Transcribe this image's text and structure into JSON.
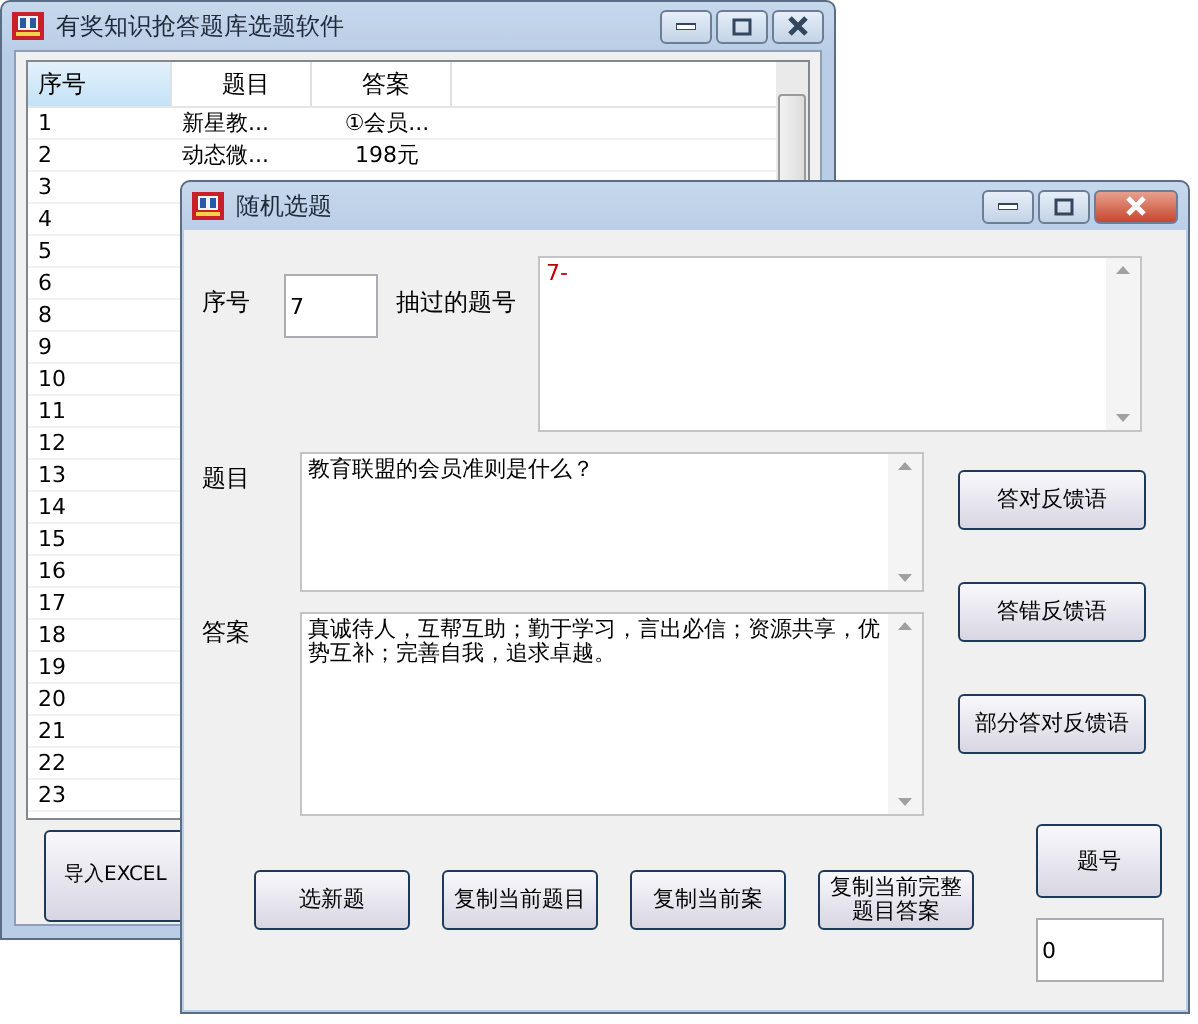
{
  "main_window": {
    "title": "有奖知识抢答题库选题软件",
    "columns": [
      "序号",
      "题目",
      "答案"
    ],
    "rows": [
      {
        "number": "1",
        "title": "新星教...",
        "answer": "①会员..."
      },
      {
        "number": "2",
        "title": "动态微...",
        "answer": "198元"
      },
      {
        "number": "3"
      },
      {
        "number": "4"
      },
      {
        "number": "5"
      },
      {
        "number": "6"
      },
      {
        "number": "8"
      },
      {
        "number": "9"
      },
      {
        "number": "10"
      },
      {
        "number": "11"
      },
      {
        "number": "12"
      },
      {
        "number": "13"
      },
      {
        "number": "14"
      },
      {
        "number": "15"
      },
      {
        "number": "16"
      },
      {
        "number": "17"
      },
      {
        "number": "18"
      },
      {
        "number": "19"
      },
      {
        "number": "20"
      },
      {
        "number": "21"
      },
      {
        "number": "22"
      },
      {
        "number": "23"
      }
    ],
    "import_button": "导入EXCEL"
  },
  "dialog": {
    "title": "随机选题",
    "serial_label": "序号",
    "serial_value": "7",
    "drawn_label": "抽过的题号",
    "drawn_value": "7-",
    "question_label": "题目",
    "question_value": "教育联盟的会员准则是什么？",
    "answer_label": "答案",
    "answer_value": "真诚待人，互帮互助；勤于学习，言出必信；资源共享，优势互补；完善自我，追求卓越。",
    "feedback_buttons": [
      "答对反馈语",
      "答错反馈语",
      "部分答对反馈语"
    ],
    "action_buttons": [
      "选新题",
      "复制当前题目",
      "复制当前案",
      "复制当前完整题目答案"
    ],
    "number_button": "题号",
    "number_value": "0"
  }
}
